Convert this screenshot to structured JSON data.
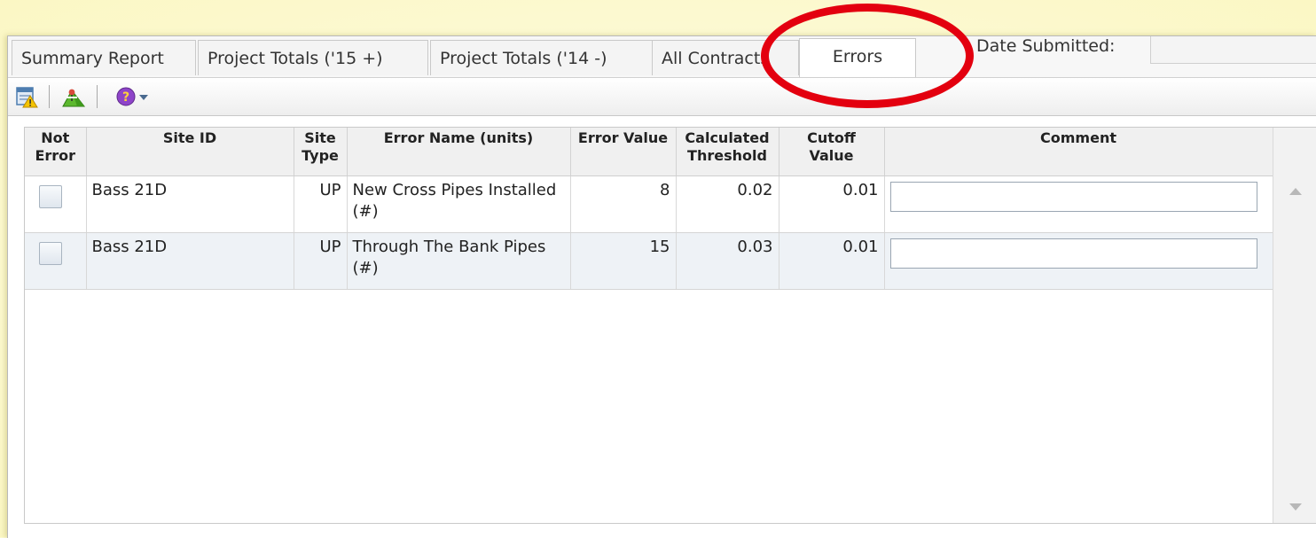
{
  "tabs": [
    {
      "label": "Summary Report"
    },
    {
      "label": "Project Totals ('15 +)"
    },
    {
      "label": "Project Totals ('14 -)"
    },
    {
      "label": "All Contracts"
    },
    {
      "label": "Errors"
    }
  ],
  "active_tab": "Errors",
  "date_submitted_label": "Date Submitted:",
  "toolbar": {
    "icons": [
      "report-warning-icon",
      "map-pin-icon",
      "help-icon"
    ]
  },
  "columns": {
    "not_error": "Not Error",
    "site_id": "Site ID",
    "site_type": "Site Type",
    "error_name": "Error Name (units)",
    "error_value": "Error Value",
    "calculated_threshold": "Calculated Threshold",
    "cutoff_value": "Cutoff Value",
    "comment": "Comment"
  },
  "rows": [
    {
      "not_error": false,
      "site_id": "Bass 21D",
      "site_type": "UP",
      "error_name": "New Cross Pipes Installed (#)",
      "error_value": "8",
      "calculated_threshold": "0.02",
      "cutoff_value": "0.01",
      "comment": ""
    },
    {
      "not_error": false,
      "site_id": "Bass 21D",
      "site_type": "UP",
      "error_name": "Through The Bank Pipes (#)",
      "error_value": "15",
      "calculated_threshold": "0.03",
      "cutoff_value": "0.01",
      "comment": ""
    }
  ],
  "colors": {
    "highlight_ring": "#e3000f",
    "background": "#fdfbd2"
  }
}
